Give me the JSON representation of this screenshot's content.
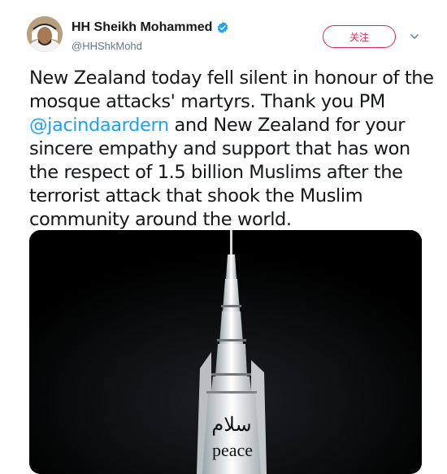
{
  "user": {
    "display_name": "HH Sheikh Mohammed",
    "handle": "@HHShkMohd",
    "verified_icon": "verified-badge-icon",
    "avatar_icon": "avatar"
  },
  "actions": {
    "follow_label": "关注",
    "more_icon": "chevron-down-icon"
  },
  "tweet": {
    "line1": "New Zealand today fell silent in honour of the",
    "line2": "mosque attacks' martyrs. Thank you PM",
    "mention": "@jacindaardern",
    "line3_rest": " and  New Zealand for your",
    "line4": "sincere empathy and support that has won",
    "line5": "the respect of 1.5 billion Muslims after the",
    "line6": "terrorist attack that shook the Muslim",
    "line7": "community around the world."
  },
  "media": {
    "arabic_text": "سلام",
    "english_text": "peace"
  },
  "colors": {
    "accent_follow": "#e0245e",
    "mention": "#1da1f2",
    "verified": "#1da1f2",
    "handle": "#657786"
  }
}
